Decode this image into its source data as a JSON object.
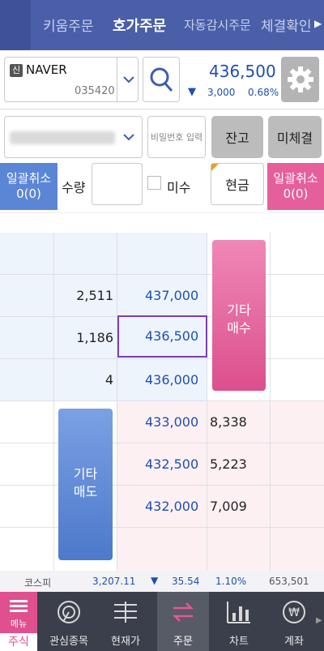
{
  "tabs": [
    "키움주문",
    "호가주문",
    "자동감시주문",
    "체결확인"
  ],
  "stock": {
    "badge": "신",
    "name": "NAVER",
    "code": "035420",
    "price": "436,500",
    "change_arrow": "▼",
    "change": "3,000",
    "change_pct": "0.68%"
  },
  "account": {
    "password_placeholder": "비밀번호 입력",
    "balance_button": "잔고",
    "unfilled_button": "미체결"
  },
  "order": {
    "cancel_all_left": "일괄취소",
    "cancel_all_left_count": "0(0)",
    "qty_label": "수량",
    "misu_label": "미수",
    "cash_label": "현금",
    "cancel_all_right": "일괄취소",
    "cancel_all_right_count": "0(0)"
  },
  "orderbook": {
    "sell": [
      {
        "qty": "2,511",
        "price": "437,000"
      },
      {
        "qty": "1,186",
        "price": "436,500"
      },
      {
        "qty": "4",
        "price": "436,000"
      }
    ],
    "buy": [
      {
        "price": "433,000",
        "qty": "8,338"
      },
      {
        "price": "432,500",
        "qty": "5,223"
      },
      {
        "price": "432,000",
        "qty": "7,009"
      }
    ],
    "other_buy": [
      "기타",
      "매수"
    ],
    "other_sell": [
      "기타",
      "매도"
    ]
  },
  "index": {
    "name": "코스피",
    "value": "3,207.11",
    "arrow": "▼",
    "change": "35.54",
    "pct": "1.10%",
    "volume": "653,501"
  },
  "nav": {
    "menu": "메뉴",
    "items": [
      "주식",
      "관심종목",
      "현재가",
      "주문",
      "차트",
      "계좌"
    ]
  },
  "colors": {
    "accent_blue": "#1d4fb3",
    "buy_pink": "#e55f9b",
    "sell_blue": "#5b86d6",
    "top_bar": "#4a5fa8"
  }
}
